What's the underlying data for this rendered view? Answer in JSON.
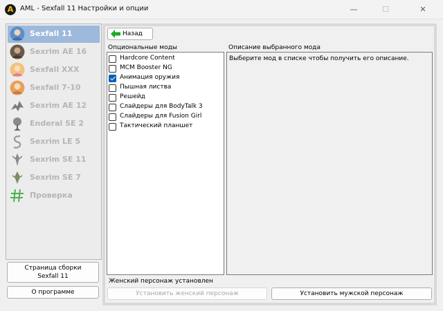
{
  "window": {
    "title": "AML - Sexfall 11 Настройки и опции",
    "app_icon_letter": "A",
    "minimize_glyph": "—",
    "maximize_glyph": "☐",
    "close_glyph": "✕"
  },
  "profiles": [
    {
      "label": "Sexfall 11",
      "selected": true,
      "icon": "character-portrait-icon",
      "color": "#5d8fc9"
    },
    {
      "label": "Sexrim AE 16",
      "selected": false,
      "icon": "character-portrait-icon",
      "color": "#6b5a4a"
    },
    {
      "label": "Sexfall XXX",
      "selected": false,
      "icon": "character-portrait-icon",
      "color": "#f2c27a"
    },
    {
      "label": "Sexfall 7-10",
      "selected": false,
      "icon": "character-portrait-icon",
      "color": "#e8a05a"
    },
    {
      "label": "Sexrim AE 12",
      "selected": false,
      "icon": "dragon-icon",
      "color": "#7a7a7a"
    },
    {
      "label": "Enderal SE 2",
      "selected": false,
      "icon": "tree-emblem-icon",
      "color": "#8a8a8a"
    },
    {
      "label": "Sexrim LE 5",
      "selected": false,
      "icon": "skyrim-logo-icon",
      "color": "#9a9a9a"
    },
    {
      "label": "Sexrim SE 11",
      "selected": false,
      "icon": "skyrim-logo-icon",
      "color": "#8a8a8a"
    },
    {
      "label": "Sexrim SE 7",
      "selected": false,
      "icon": "skyrim-logo-icon",
      "color": "#7c8a6a"
    },
    {
      "label": "Проверка",
      "selected": false,
      "icon": "hash-icon",
      "color": "#4caf50"
    }
  ],
  "sidebar_buttons": {
    "page_label_line1": "Страница сборки",
    "page_label_line2": "Sexfall 11",
    "about_label": "О программе"
  },
  "back_button": {
    "label": "Назад",
    "icon": "back-arrow-icon",
    "icon_color": "#1fa82a"
  },
  "optional_mods": {
    "header": "Опциональные моды",
    "items": [
      {
        "label": "Hardcore Content",
        "checked": false
      },
      {
        "label": "MCM Booster NG",
        "checked": false
      },
      {
        "label": "Анимация оружия",
        "checked": true
      },
      {
        "label": "Пышная листва",
        "checked": false
      },
      {
        "label": "Решейд",
        "checked": false
      },
      {
        "label": "Слайдеры для BodyTalk 3",
        "checked": false
      },
      {
        "label": "Слайдеры для Fusion Girl",
        "checked": false
      },
      {
        "label": "Тактический планшет",
        "checked": false
      }
    ]
  },
  "description": {
    "header": "Описание выбранного мода",
    "text": "Выберите мод в списке чтобы получить его описание."
  },
  "status": {
    "text": "Женский персонаж установлен"
  },
  "install_buttons": {
    "female_label": "Установить женский персонаж",
    "female_enabled": false,
    "male_label": "Установить мужской персонаж",
    "male_enabled": true
  }
}
